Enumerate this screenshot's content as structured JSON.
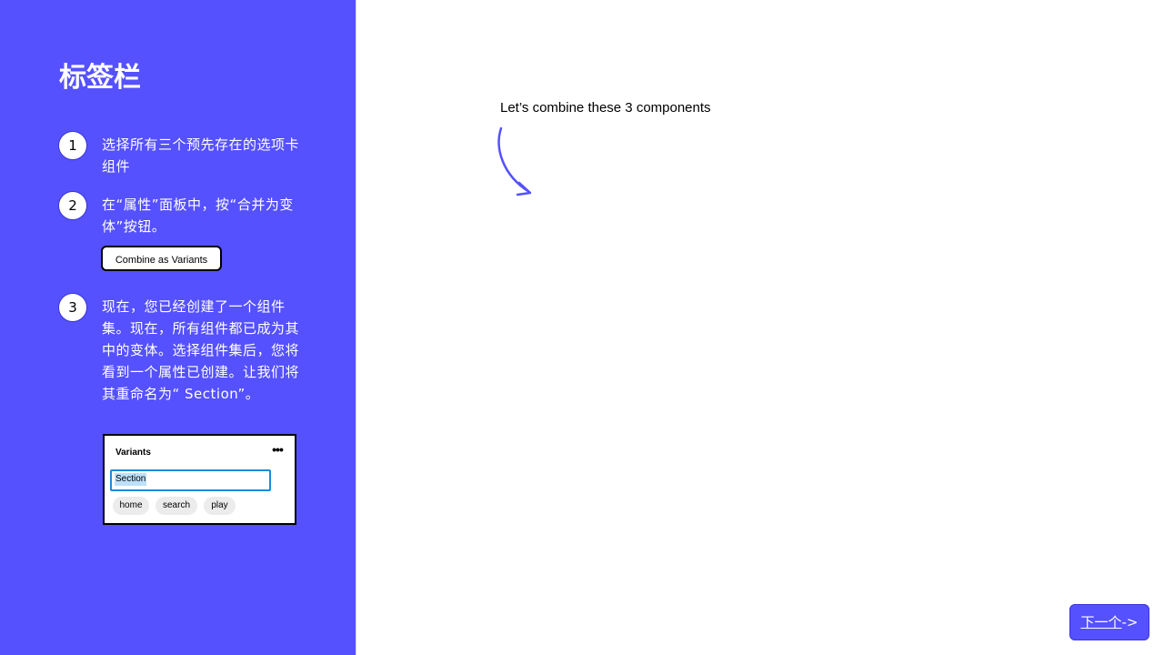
{
  "colors": {
    "sidebar_bg": "#5551ff",
    "focus_border": "#1e8ad6",
    "selection_bg": "#bde0fb",
    "chip_bg": "#ececec"
  },
  "sidebar": {
    "title": "标签栏",
    "steps": [
      {
        "number": "1",
        "text": "选择所有三个预先存在的选项卡组件"
      },
      {
        "number": "2",
        "text": "在“属性”面板中，按“合并为变体”按钮。",
        "button_label": "Combine as Variants"
      },
      {
        "number": "3",
        "text": "现在，您已经创建了一个组件集。现在，所有组件都已成为其中的变体。选择组件集后，您将看到一个属性已创建。让我们将其重命名为“ Section”。"
      }
    ],
    "variants_panel": {
      "title": "Variants",
      "more_icon": "ellipsis-icon",
      "input_value": "Section",
      "chips": [
        "home",
        "search",
        "play"
      ]
    }
  },
  "canvas": {
    "caption": "Let’s combine these 3 components",
    "arrow_icon": "curved-arrow-icon"
  },
  "footer": {
    "next_label": "下一个",
    "next_suffix": "->"
  }
}
